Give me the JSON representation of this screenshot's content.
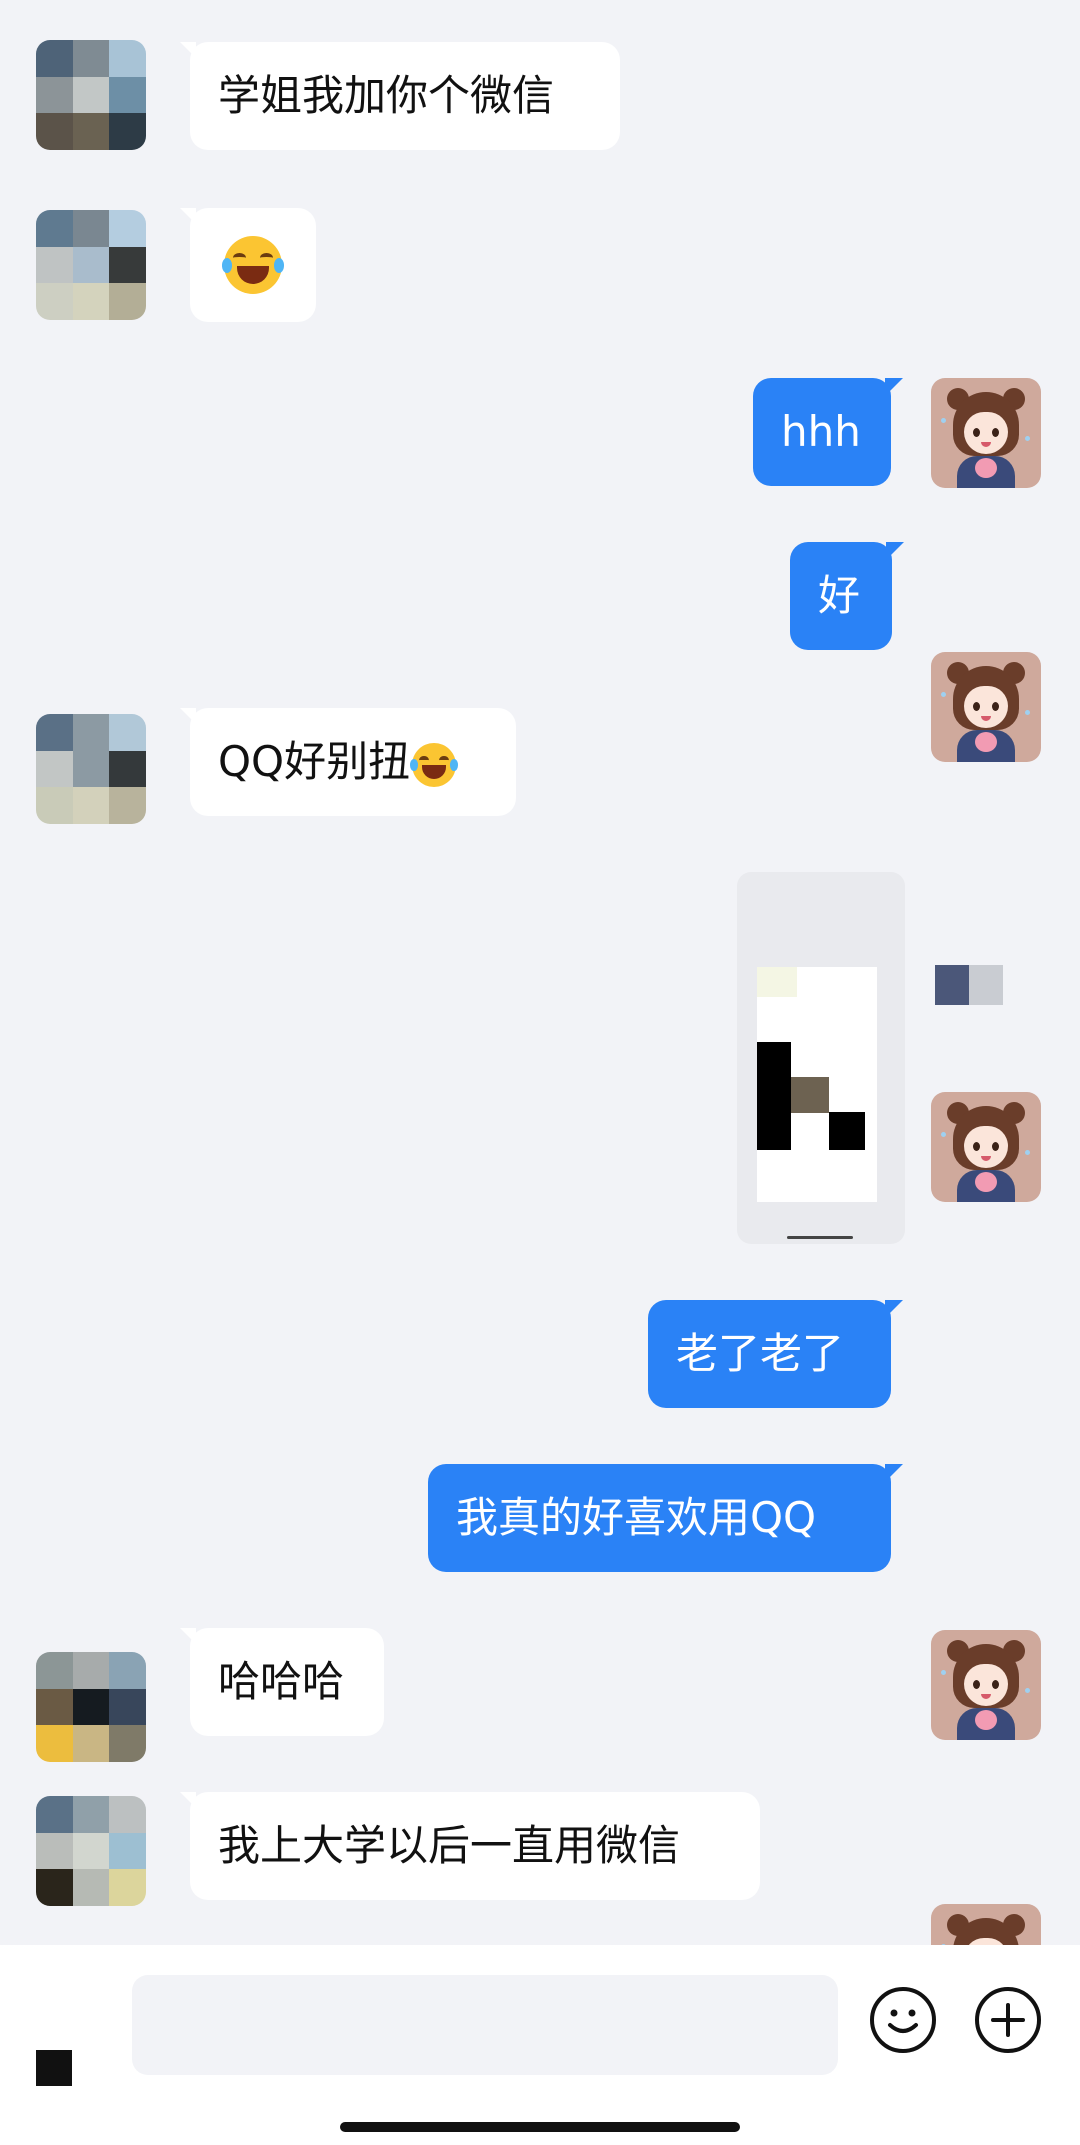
{
  "messages": [
    {
      "side": "incoming",
      "text": "学姐我加你个微信"
    },
    {
      "side": "incoming",
      "emoji": "tears-of-joy-emoji"
    },
    {
      "side": "outgoing",
      "text": "hhh"
    },
    {
      "side": "outgoing",
      "text": "好"
    },
    {
      "side": "incoming",
      "text": "QQ好别扭",
      "emoji": "tears-of-joy-emoji"
    },
    {
      "side": "outgoing",
      "image": "shared-screenshot-image"
    },
    {
      "side": "outgoing",
      "text": "老了老了"
    },
    {
      "side": "outgoing",
      "text": "我真的好喜欢用QQ"
    },
    {
      "side": "incoming",
      "text": "哈哈哈"
    },
    {
      "side": "incoming",
      "text": "我上大学以后一直用微信"
    }
  ],
  "input_bar": {
    "field_value": "",
    "emoji_button_icon": "smiley-icon",
    "plus_button_icon": "plus-icon"
  },
  "colors": {
    "background": "#f2f3f7",
    "outgoing_bubble": "#2a82f6",
    "incoming_bubble": "#ffffff"
  }
}
